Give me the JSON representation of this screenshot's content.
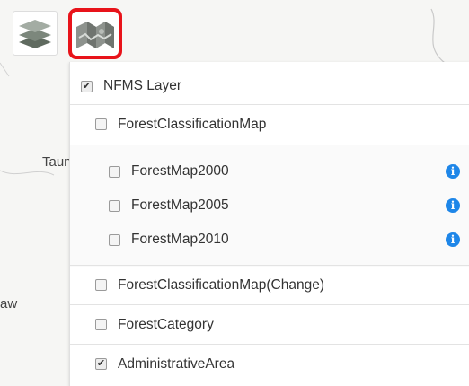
{
  "map": {
    "place_labels": [
      "Taunggyi",
      "aw"
    ]
  },
  "toolbar": {
    "layers_icon": "layers-stack-icon",
    "map_icon": "folded-map-icon",
    "highlight_color": "#e8131a"
  },
  "layer_panel": {
    "root": {
      "label": "NFMS Layer",
      "checked": true
    },
    "groups": [
      {
        "label": "ForestClassificationMap",
        "checked": false,
        "children": [
          {
            "label": "ForestMap2000",
            "checked": false,
            "info_icon": "info-icon"
          },
          {
            "label": "ForestMap2005",
            "checked": false,
            "info_icon": "info-icon"
          },
          {
            "label": "ForestMap2010",
            "checked": false,
            "info_icon": "info-icon"
          }
        ]
      },
      {
        "label": "ForestClassificationMap(Change)",
        "checked": false
      },
      {
        "label": "ForestCategory",
        "checked": false
      },
      {
        "label": "AdministrativeArea",
        "checked": true
      }
    ],
    "info_color": "#1e86e8"
  }
}
